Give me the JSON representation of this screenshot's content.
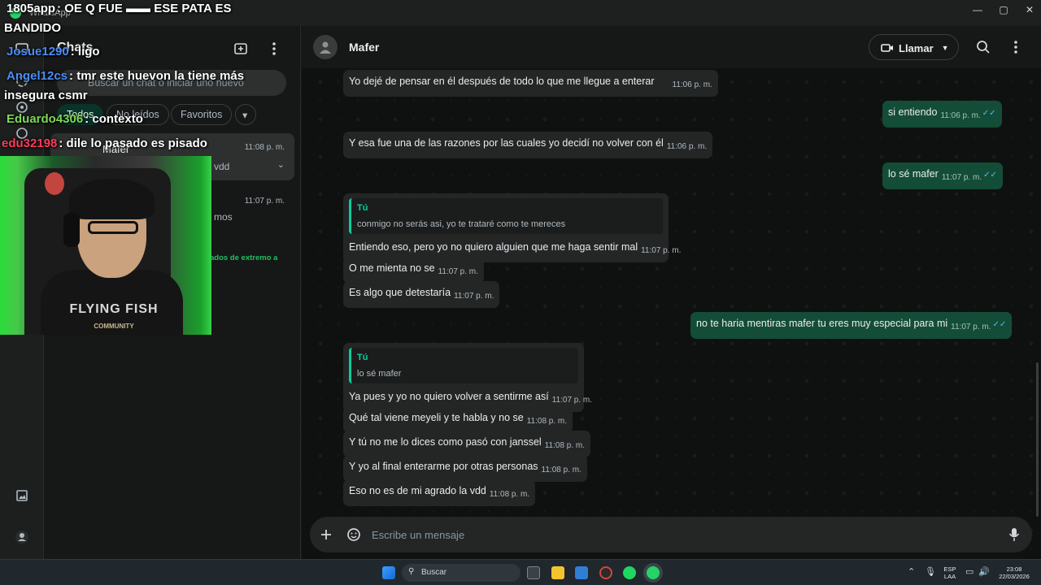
{
  "window": {
    "app_title": "WhatsApp",
    "minimize": "—",
    "maximize": "▢",
    "close": "✕"
  },
  "sidebar": {
    "title": "Chats",
    "search_placeholder": "Buscar un chat o iniciar uno nuevo",
    "filters": [
      "Todos",
      "No leídos",
      "Favoritos",
      "▾"
    ],
    "chats": [
      {
        "name": "Mafer",
        "time": "11:08 p. m.",
        "preview": "vdd"
      },
      {
        "name": "",
        "time": "11:07 p. m.",
        "preview": "mos"
      }
    ],
    "green_text": "ados de extremo a"
  },
  "chat": {
    "contact": "Mafer",
    "call_label": "Llamar",
    "messages": [
      {
        "dir": "in",
        "text": "Yo dejé de pensar en él después de todo lo que me llegue a enterar",
        "time": "11:06 p. m."
      },
      {
        "dir": "out",
        "text": "si entiendo",
        "time": "11:06 p. m."
      },
      {
        "dir": "in",
        "text": "Y esa fue una de las razones por las cuales yo decidí no volver con él",
        "time": "11:06 p. m."
      },
      {
        "dir": "out",
        "text": "lo sé mafer",
        "time": "11:07 p. m."
      },
      {
        "dir": "in",
        "quote_name": "Tú",
        "quote_text": "conmigo no serás asi, yo te trataré como te mereces",
        "text": "Entiendo eso, pero yo no quiero alguien que me haga sentir mal",
        "time": "11:07 p. m."
      },
      {
        "dir": "in",
        "text": "O me mienta no se",
        "time": "11:07 p. m."
      },
      {
        "dir": "in",
        "text": "Es algo que detestaría",
        "time": "11:07 p. m."
      },
      {
        "dir": "out",
        "text": "no te haria mentiras mafer tu eres muy especial para mi",
        "time": "11:07 p. m."
      },
      {
        "dir": "in",
        "quote_name": "Tú",
        "quote_text": "lo sé mafer",
        "text": "Ya pues y yo no quiero volver a sentirme así",
        "time": "11:07 p. m."
      },
      {
        "dir": "in",
        "text": "Qué tal viene meyeli y te habla y no se",
        "time": "11:08 p. m."
      },
      {
        "dir": "in",
        "text": "Y tú no me lo dices como pasó con janssel",
        "time": "11:08 p. m."
      },
      {
        "dir": "in",
        "text": "Y yo al final enterarme por otras personas",
        "time": "11:08 p. m."
      },
      {
        "dir": "in",
        "text": "Eso no es de mi agrado la vdd",
        "time": "11:08 p. m."
      }
    ],
    "tick": "✓✓",
    "composer_placeholder": "Escribe un mensaje"
  },
  "overlay": [
    {
      "user": "1805app",
      "text": ": OE Q FUE  ▬▬  ESE PATA ES",
      "color": "#ffffff"
    },
    {
      "user": "",
      "text": "BANDIDO",
      "color": "#ffffff"
    },
    {
      "user": "Josue1290",
      "text": ": ligo",
      "color": "#4b8df8"
    },
    {
      "user": "Angel12cs",
      "text": ": tmr este huevon la tiene más",
      "color": "#4b8df8"
    },
    {
      "user": "",
      "text": "insegura csmr",
      "color": "#ffffff"
    },
    {
      "user": "Eduardo4306",
      "text": ": contexto",
      "color": "#7ed957"
    },
    {
      "user": "edu32198",
      "text": ": dile lo pasado es pisado",
      "color": "#ff3b5c"
    }
  ],
  "webcam": {
    "shirt_line1": "FLYING FISH",
    "shirt_line2": "COMMUNITY"
  },
  "taskbar": {
    "search": "Buscar",
    "lang": "ESP",
    "lang2": "LAA",
    "time": "23:08",
    "date": "22/03/2026"
  }
}
